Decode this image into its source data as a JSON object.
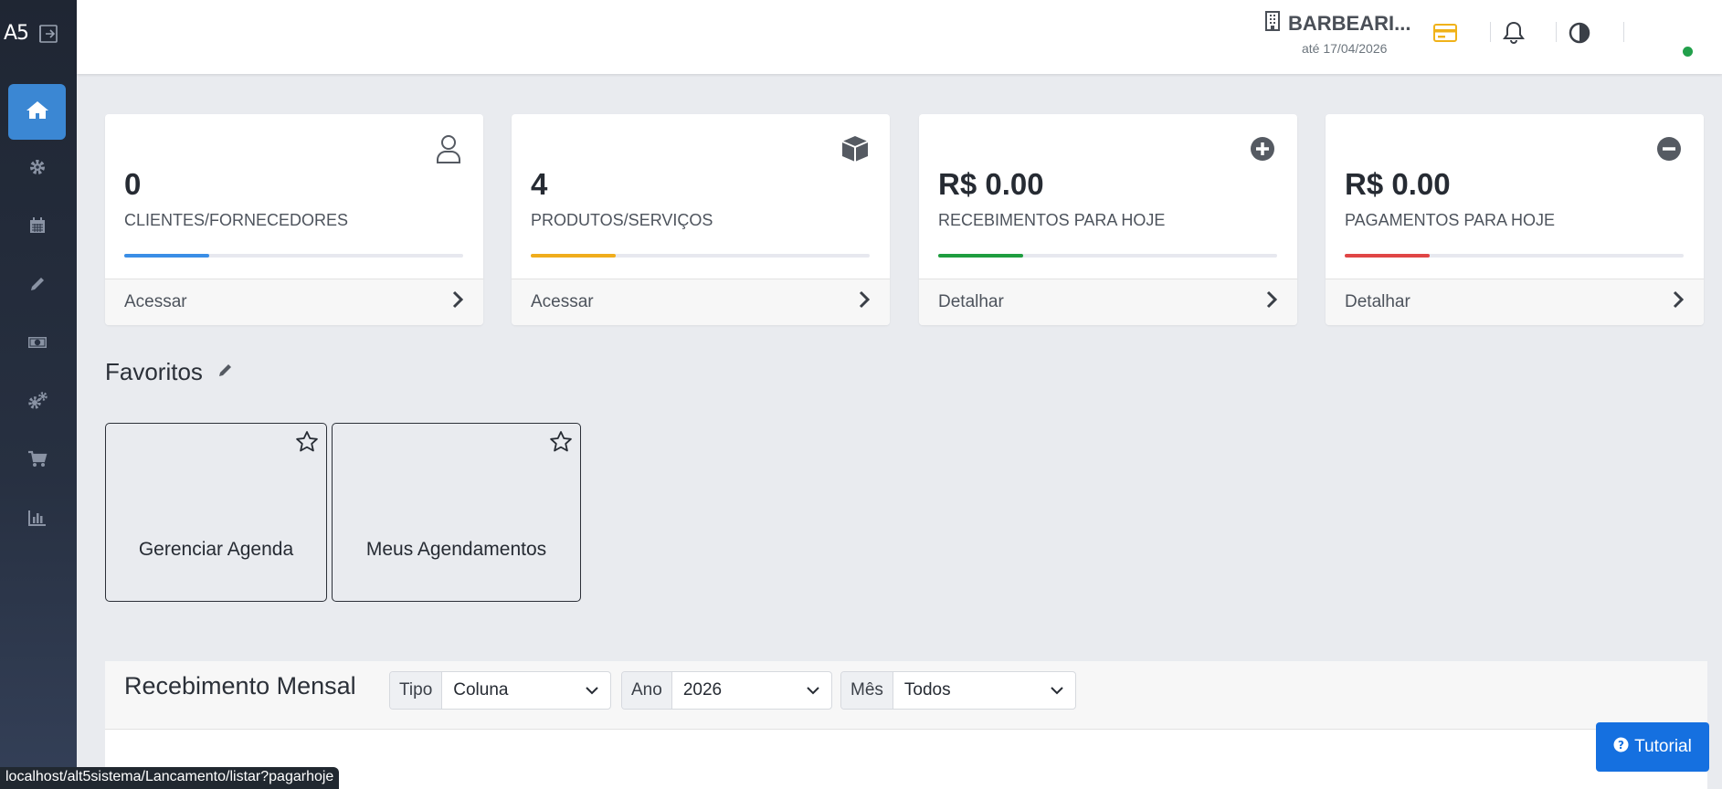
{
  "sidebar": {
    "logo": "A5",
    "items": [
      {
        "name": "home-icon",
        "active": true
      },
      {
        "name": "gear-icon"
      },
      {
        "name": "calendar-icon"
      },
      {
        "name": "pencil-icon"
      },
      {
        "name": "money-icon"
      },
      {
        "name": "gears-icon"
      },
      {
        "name": "cart-icon"
      },
      {
        "name": "bar-chart-icon"
      }
    ]
  },
  "header": {
    "company_name": "BARBEARI...",
    "company_date": "até 17/04/2026",
    "icons": [
      "credit-card-icon",
      "bell-icon",
      "contrast-icon"
    ],
    "colors": {
      "card_icon": "#f0b219",
      "online_dot": "#22a04b"
    }
  },
  "stats": [
    {
      "value": "0",
      "label": "CLIENTES/FORNECEDORES",
      "action": "Acessar",
      "color": "#3a8ee6",
      "progress": 0.25,
      "icon": "user-icon"
    },
    {
      "value": "4",
      "label": "PRODUTOS/SERVIÇOS",
      "action": "Acessar",
      "color": "#f0ad1c",
      "progress": 0.25,
      "icon": "box-icon"
    },
    {
      "value": "R$ 0.00",
      "label": "RECEBIMENTOS PARA HOJE",
      "action": "Detalhar",
      "color": "#1f9d3f",
      "progress": 0.25,
      "icon": "plus-circle-icon"
    },
    {
      "value": "R$ 0.00",
      "label": "PAGAMENTOS PARA HOJE",
      "action": "Detalhar",
      "color": "#e04545",
      "progress": 0.25,
      "icon": "minus-circle-icon"
    }
  ],
  "favorites": {
    "title": "Favoritos",
    "items": [
      {
        "label": "Gerenciar Agenda"
      },
      {
        "label": "Meus Agendamentos"
      }
    ]
  },
  "chart_panel": {
    "title": "Recebimento Mensal",
    "filters": [
      {
        "label": "Tipo",
        "value": "Coluna"
      },
      {
        "label": "Ano",
        "value": "2026"
      },
      {
        "label": "Mês",
        "value": "Todos"
      }
    ]
  },
  "tutorial_button": "Tutorial",
  "status_url": "localhost/alt5sistema/Lancamento/listar?pagarhoje"
}
